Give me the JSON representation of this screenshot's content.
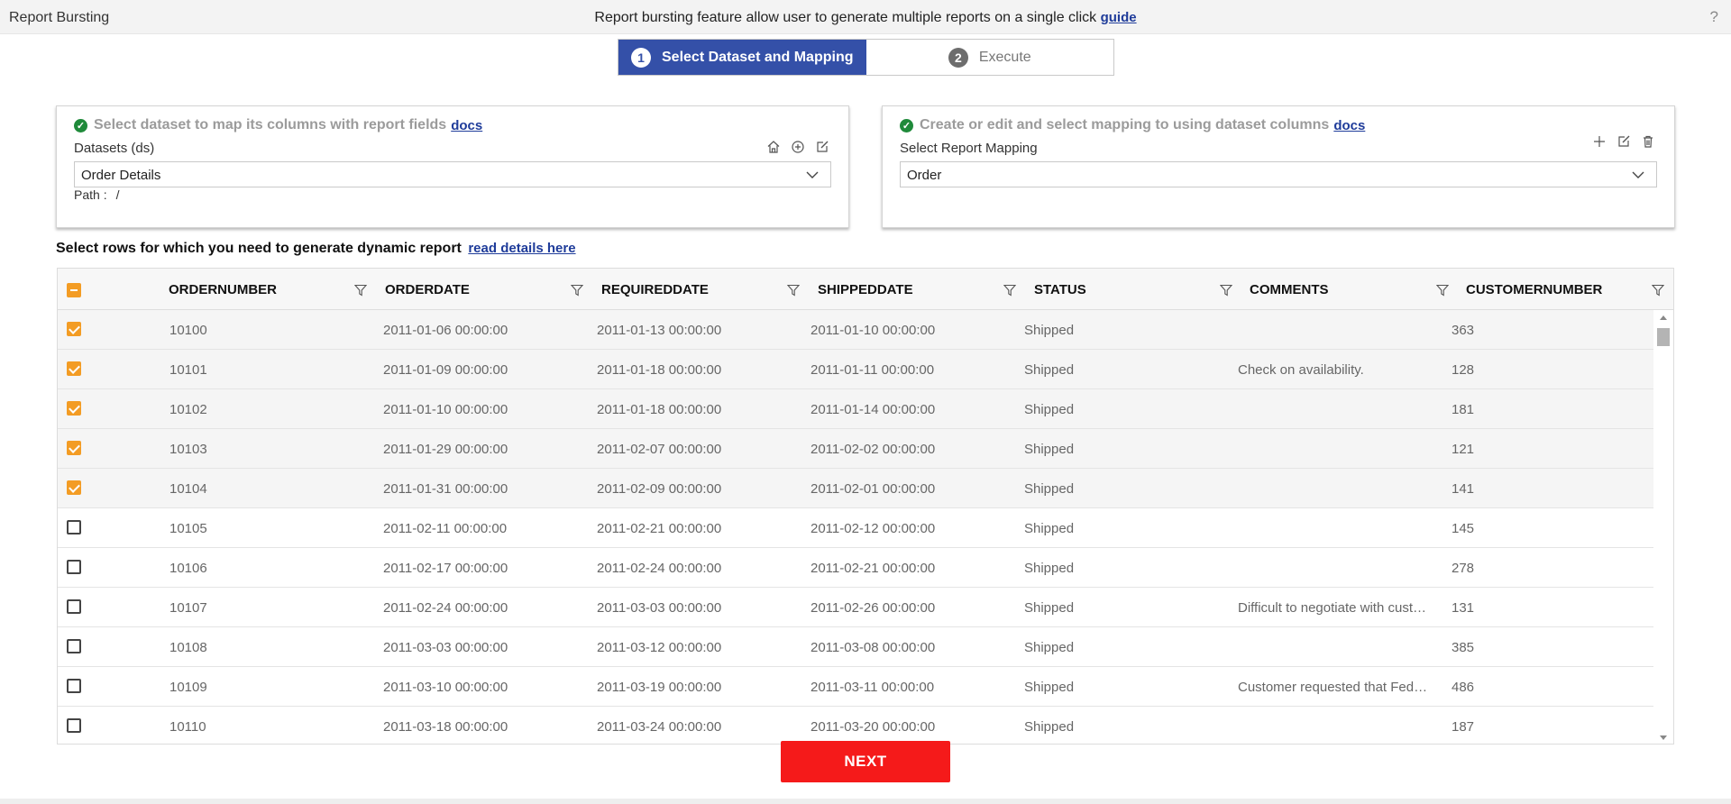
{
  "header": {
    "app_title": "Report Bursting",
    "description": "Report bursting feature allow user to generate multiple reports on a single click",
    "guide_link": "guide",
    "help": "?"
  },
  "stepper": [
    {
      "num": "1",
      "label": "Select Dataset and Mapping",
      "active": true
    },
    {
      "num": "2",
      "label": "Execute",
      "active": false
    }
  ],
  "dataset_card": {
    "title": "Select dataset to map its columns with report fields",
    "docs_link": "docs",
    "label": "Datasets (ds)",
    "selected": "Order Details",
    "path_label": "Path :",
    "path_value": "/",
    "icons": [
      "home-icon",
      "add-circle-icon",
      "edit-icon"
    ]
  },
  "mapping_card": {
    "title": "Create or edit and select mapping to using dataset columns",
    "docs_link": "docs",
    "label": "Select Report Mapping",
    "selected": "Order",
    "icons": [
      "plus-icon",
      "edit-icon",
      "trash-icon"
    ]
  },
  "table_section": {
    "title": "Select rows for which you need to generate dynamic report",
    "link": "read details here"
  },
  "table": {
    "columns": [
      "ORDERNUMBER",
      "ORDERDATE",
      "REQUIREDDATE",
      "SHIPPEDDATE",
      "STATUS",
      "COMMENTS",
      "CUSTOMERNUMBER"
    ],
    "rows": [
      {
        "checked": true,
        "cells": [
          "10100",
          "2011-01-06 00:00:00",
          "2011-01-13 00:00:00",
          "2011-01-10 00:00:00",
          "Shipped",
          "",
          "363"
        ]
      },
      {
        "checked": true,
        "cells": [
          "10101",
          "2011-01-09 00:00:00",
          "2011-01-18 00:00:00",
          "2011-01-11 00:00:00",
          "Shipped",
          "Check on availability.",
          "128"
        ]
      },
      {
        "checked": true,
        "cells": [
          "10102",
          "2011-01-10 00:00:00",
          "2011-01-18 00:00:00",
          "2011-01-14 00:00:00",
          "Shipped",
          "",
          "181"
        ]
      },
      {
        "checked": true,
        "cells": [
          "10103",
          "2011-01-29 00:00:00",
          "2011-02-07 00:00:00",
          "2011-02-02 00:00:00",
          "Shipped",
          "",
          "121"
        ]
      },
      {
        "checked": true,
        "cells": [
          "10104",
          "2011-01-31 00:00:00",
          "2011-02-09 00:00:00",
          "2011-02-01 00:00:00",
          "Shipped",
          "",
          "141"
        ]
      },
      {
        "checked": false,
        "cells": [
          "10105",
          "2011-02-11 00:00:00",
          "2011-02-21 00:00:00",
          "2011-02-12 00:00:00",
          "Shipped",
          "",
          "145"
        ]
      },
      {
        "checked": false,
        "cells": [
          "10106",
          "2011-02-17 00:00:00",
          "2011-02-24 00:00:00",
          "2011-02-21 00:00:00",
          "Shipped",
          "",
          "278"
        ]
      },
      {
        "checked": false,
        "cells": [
          "10107",
          "2011-02-24 00:00:00",
          "2011-03-03 00:00:00",
          "2011-02-26 00:00:00",
          "Shipped",
          "Difficult to negotiate with cust…",
          "131"
        ]
      },
      {
        "checked": false,
        "cells": [
          "10108",
          "2011-03-03 00:00:00",
          "2011-03-12 00:00:00",
          "2011-03-08 00:00:00",
          "Shipped",
          "",
          "385"
        ]
      },
      {
        "checked": false,
        "cells": [
          "10109",
          "2011-03-10 00:00:00",
          "2011-03-19 00:00:00",
          "2011-03-11 00:00:00",
          "Shipped",
          "Customer requested that Fed…",
          "486"
        ]
      },
      {
        "checked": false,
        "cells": [
          "10110",
          "2011-03-18 00:00:00",
          "2011-03-24 00:00:00",
          "2011-03-20 00:00:00",
          "Shipped",
          "",
          "187"
        ]
      }
    ]
  },
  "next_button": "NEXT",
  "colors": {
    "primary": "#3450a8",
    "checkbox": "#f39c24",
    "next": "#f51a1a",
    "success": "#1f8a3a",
    "link": "#1f3c9a"
  }
}
